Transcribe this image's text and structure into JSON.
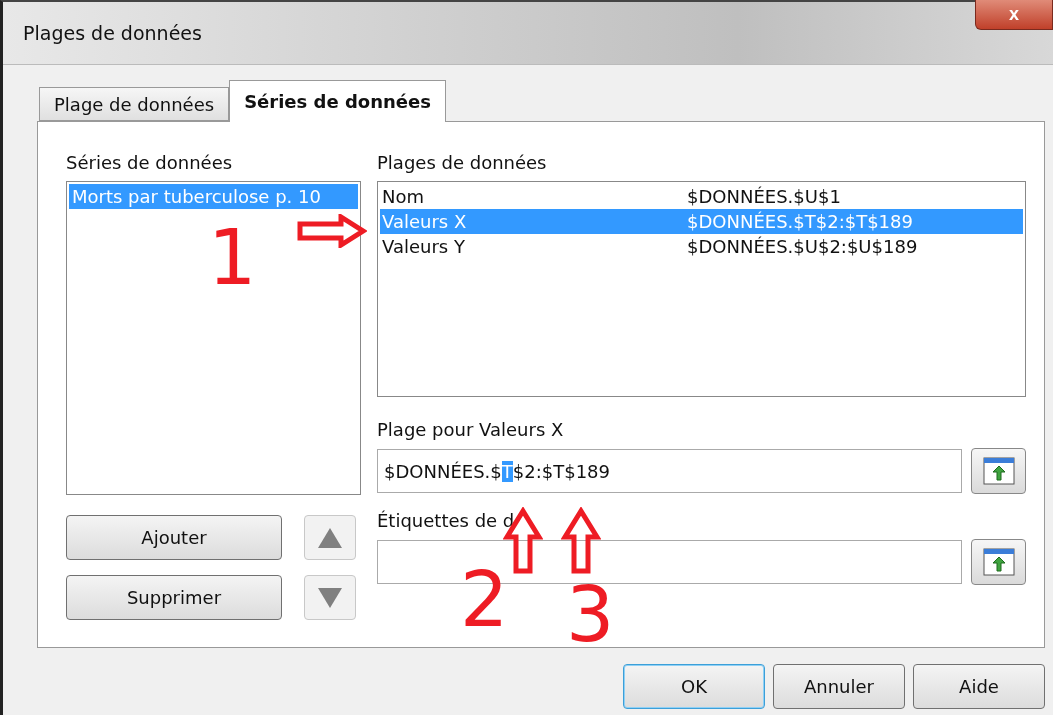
{
  "window": {
    "title": "Plages de données",
    "close_label": "x"
  },
  "tabs": [
    {
      "label": "Plage de données",
      "selected": false
    },
    {
      "label": "Séries de données",
      "selected": true
    }
  ],
  "series": {
    "label": "Séries de données",
    "items": [
      {
        "label": "Morts par tuberculose p. 10",
        "selected": true
      }
    ]
  },
  "ranges": {
    "label": "Plages de données",
    "rows": [
      {
        "role": "Nom",
        "range": "$DONNÉES.$U$1",
        "selected": false
      },
      {
        "role": "Valeurs X",
        "range": "$DONNÉES.$T$2:$T$189",
        "selected": true
      },
      {
        "role": "Valeurs Y",
        "range": "$DONNÉES.$U$2:$U$189",
        "selected": false
      }
    ]
  },
  "range_field": {
    "label": "Plage pour Valeurs X",
    "value_parts": [
      {
        "text": "$DONNÉES.$",
        "selected": false
      },
      {
        "text": "T",
        "selected": true
      },
      {
        "text": "$2:$T$189",
        "selected": false
      }
    ]
  },
  "labels_field": {
    "label": "Étiquettes de d"
  },
  "series_buttons": [
    "Ajouter",
    "Supprimer"
  ],
  "move_buttons": [
    {
      "kind": "up",
      "disabled": true
    },
    {
      "kind": "down",
      "disabled": true
    }
  ],
  "buttons": [
    {
      "label": "OK",
      "default": true
    },
    {
      "label": "Annuler",
      "default": false
    },
    {
      "label": "Aide",
      "default": false
    }
  ],
  "annotations": [
    {
      "number": "1",
      "kind": "right"
    },
    {
      "number": "2",
      "kind": "up"
    },
    {
      "number": "3",
      "kind": "up"
    }
  ]
}
